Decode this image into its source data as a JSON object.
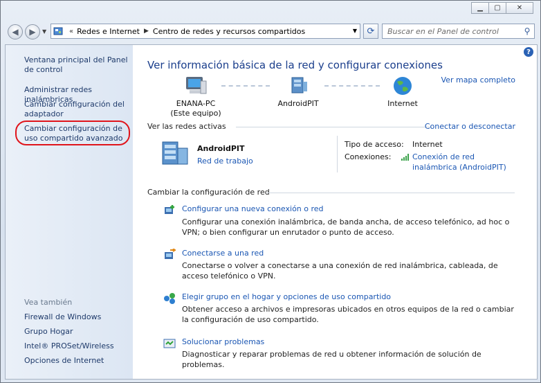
{
  "address": {
    "segments": [
      "Redes e Internet",
      "Centro de redes y recursos compartidos"
    ]
  },
  "search": {
    "placeholder": "Buscar en el Panel de control"
  },
  "sidebar": {
    "links": [
      "Ventana principal del Panel de control",
      "Administrar redes inalámbricas",
      "Cambiar configuración del adaptador",
      "Cambiar configuración de uso compartido avanzado"
    ],
    "see_also_title": "Vea también",
    "see_also": [
      "Firewall de Windows",
      "Grupo Hogar",
      "Intel® PROSet/Wireless",
      "Opciones de Internet"
    ]
  },
  "main": {
    "title": "Ver información básica de la red y configurar conexiones",
    "map_link": "Ver mapa completo",
    "nodes": [
      {
        "name": "ENANA-PC",
        "sub": "(Este equipo)"
      },
      {
        "name": "AndroidPIT",
        "sub": ""
      },
      {
        "name": "Internet",
        "sub": ""
      }
    ],
    "active_header": "Ver las redes activas",
    "connect_link": "Conectar o desconectar",
    "network": {
      "name": "AndroidPIT",
      "type_link": "Red de trabajo"
    },
    "access_label": "Tipo de acceso:",
    "access_value": "Internet",
    "connections_label": "Conexiones:",
    "connection_value": "Conexión de red inalámbrica (AndroidPIT)",
    "settings_header": "Cambiar la configuración de red",
    "tasks": [
      {
        "link": "Configurar una nueva conexión o red",
        "desc": "Configurar una conexión inalámbrica, de banda ancha, de acceso telefónico, ad hoc o VPN; o bien configurar un enrutador o punto de acceso."
      },
      {
        "link": "Conectarse a una red",
        "desc": "Conectarse o volver a conectarse a una conexión de red inalámbrica, cableada, de acceso telefónico o VPN."
      },
      {
        "link": "Elegir grupo en el hogar y opciones de uso compartido",
        "desc": "Obtener acceso a archivos e impresoras ubicados en otros equipos de la red o cambiar la configuración de uso compartido."
      },
      {
        "link": "Solucionar problemas",
        "desc": "Diagnosticar y reparar problemas de red u obtener información de solución de problemas."
      }
    ]
  }
}
